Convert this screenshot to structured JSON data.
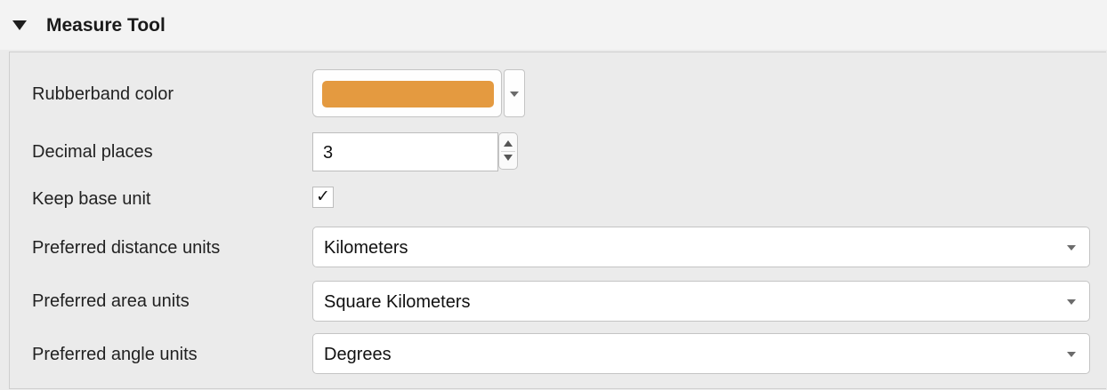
{
  "section": {
    "title": "Measure Tool",
    "expanded": true
  },
  "rows": {
    "rubberband": {
      "label": "Rubberband color",
      "color": "#e49a40"
    },
    "decimal": {
      "label": "Decimal places",
      "value": "3"
    },
    "keep_base": {
      "label": "Keep base unit",
      "checked": true,
      "check_glyph": "✓"
    },
    "distance": {
      "label": "Preferred distance units",
      "value": "Kilometers"
    },
    "area": {
      "label": "Preferred area units",
      "value": "Square Kilometers"
    },
    "angle": {
      "label": "Preferred angle units",
      "value": "Degrees"
    }
  },
  "icons": {
    "collapse": "triangle-down-icon",
    "dropdown": "chevron-down-icon",
    "stepper": "up-down-stepper-icon",
    "checkmark": "checkmark-icon"
  },
  "colors": {
    "header_bg": "#f3f3f3",
    "panel_bg": "#ebebeb",
    "accent_swatch": "#e49a40"
  }
}
